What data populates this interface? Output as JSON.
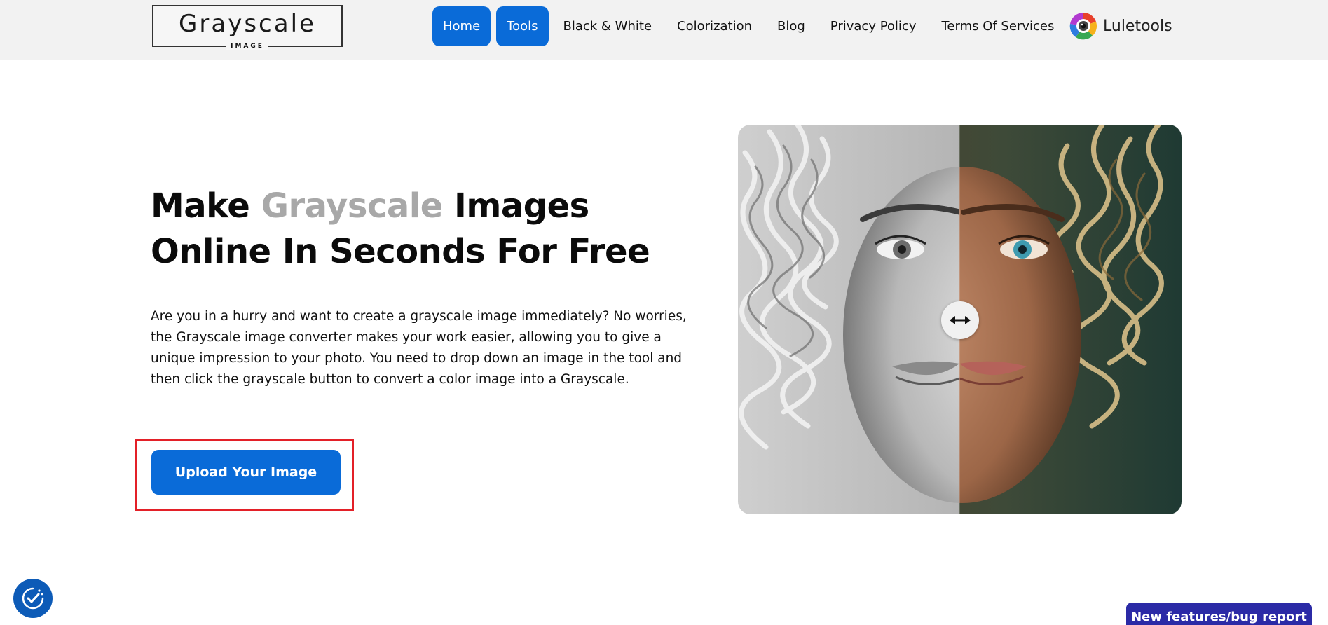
{
  "header": {
    "logo_main": "Grayscale",
    "logo_sub": "IMAGE",
    "nav": [
      {
        "label": "Home",
        "active": true
      },
      {
        "label": "Tools",
        "active": true
      },
      {
        "label": "Black & White"
      },
      {
        "label": "Colorization"
      },
      {
        "label": "Blog"
      },
      {
        "label": "Privacy Policy"
      },
      {
        "label": "Terms Of Services"
      }
    ],
    "brand": "Luletools"
  },
  "hero": {
    "title_part1": "Make ",
    "title_accent": "Grayscale",
    "title_part2": " Images Online In Seconds For Free",
    "description": "Are you in a hurry and want to create a grayscale image immediately? No worries, the Grayscale image converter makes your work easier, allowing you to give a unique impression to your photo. You need to drop down an image in the tool and then click the grayscale button to convert a color image into a Grayscale.",
    "upload_label": "Upload Your Image"
  },
  "compare": {
    "handle_icon": "double-arrow-icon"
  },
  "footer": {
    "accessibility_icon": "accessibility-check-icon",
    "feature_button": "New features/bug report"
  },
  "colors": {
    "accent": "#0a6bd8",
    "highlight_frame": "#e32028",
    "feature_button": "#2b2aa6"
  }
}
